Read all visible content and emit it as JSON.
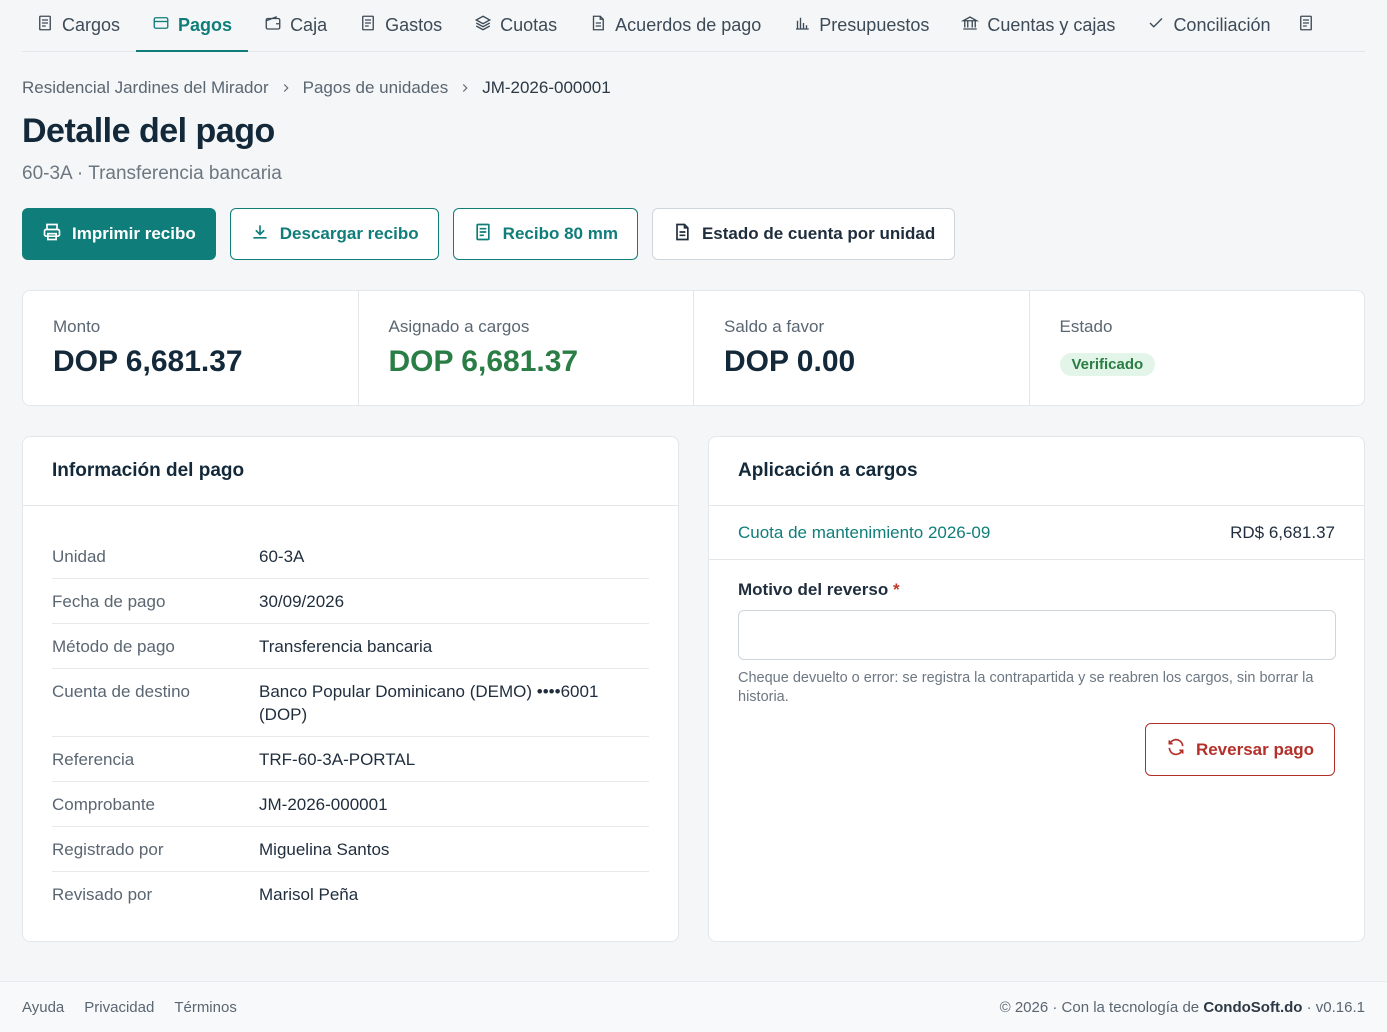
{
  "nav": {
    "items": [
      {
        "label": "Cargos",
        "icon": "receipt-icon"
      },
      {
        "label": "Pagos",
        "icon": "credit-card-icon",
        "active": true
      },
      {
        "label": "Caja",
        "icon": "wallet-icon"
      },
      {
        "label": "Gastos",
        "icon": "receipt-icon"
      },
      {
        "label": "Cuotas",
        "icon": "layers-icon"
      },
      {
        "label": "Acuerdos de pago",
        "icon": "document-icon"
      },
      {
        "label": "Presupuestos",
        "icon": "bar-chart-icon"
      },
      {
        "label": "Cuentas y cajas",
        "icon": "bank-icon"
      },
      {
        "label": "Conciliación",
        "icon": "check-icon"
      }
    ],
    "more_icon": "receipt-icon"
  },
  "breadcrumb": {
    "root": "Residencial Jardines del Mirador",
    "section": "Pagos de unidades",
    "current": "JM-2026-000001"
  },
  "page": {
    "title": "Detalle del pago",
    "subtitle": "60-3A · Transferencia bancaria"
  },
  "actions": {
    "print": "Imprimir recibo",
    "download": "Descargar recibo",
    "receipt80": "Recibo 80 mm",
    "statement": "Estado de cuenta por unidad"
  },
  "stats": {
    "amount_label": "Monto",
    "amount_value": "DOP 6,681.37",
    "assigned_label": "Asignado a cargos",
    "assigned_value": "DOP 6,681.37",
    "credit_label": "Saldo a favor",
    "credit_value": "DOP 0.00",
    "status_label": "Estado",
    "status_value": "Verificado"
  },
  "info": {
    "title": "Información del pago",
    "rows": [
      {
        "label": "Unidad",
        "value": "60-3A"
      },
      {
        "label": "Fecha de pago",
        "value": "30/09/2026"
      },
      {
        "label": "Método de pago",
        "value": "Transferencia bancaria"
      },
      {
        "label": "Cuenta de destino",
        "value": "Banco Popular Dominicano (DEMO) ••••6001 (DOP)"
      },
      {
        "label": "Referencia",
        "value": "TRF-60-3A-PORTAL"
      },
      {
        "label": "Comprobante",
        "value": "JM-2026-000001"
      },
      {
        "label": "Registrado por",
        "value": "Miguelina Santos"
      },
      {
        "label": "Revisado por",
        "value": "Marisol Peña"
      }
    ]
  },
  "application": {
    "title": "Aplicación a cargos",
    "charge_label": "Cuota de mantenimiento 2026-09",
    "charge_amount": "RD$ 6,681.37",
    "reason_label": "Motivo del reverso",
    "required_mark": "*",
    "reason_value": "",
    "help_text": "Cheque devuelto o error: se registra la contrapartida y se reabren los cargos, sin borrar la historia.",
    "reverse_button": "Reversar pago"
  },
  "footer": {
    "help": "Ayuda",
    "privacy": "Privacidad",
    "terms": "Términos",
    "copyright_prefix": "© 2026 · Con la tecnología de",
    "brand": "CondoSoft.do",
    "version": "· v0.16.1"
  },
  "colors": {
    "accent": "#0f7e7a",
    "success": "#2a7d45",
    "danger": "#b3312a"
  }
}
